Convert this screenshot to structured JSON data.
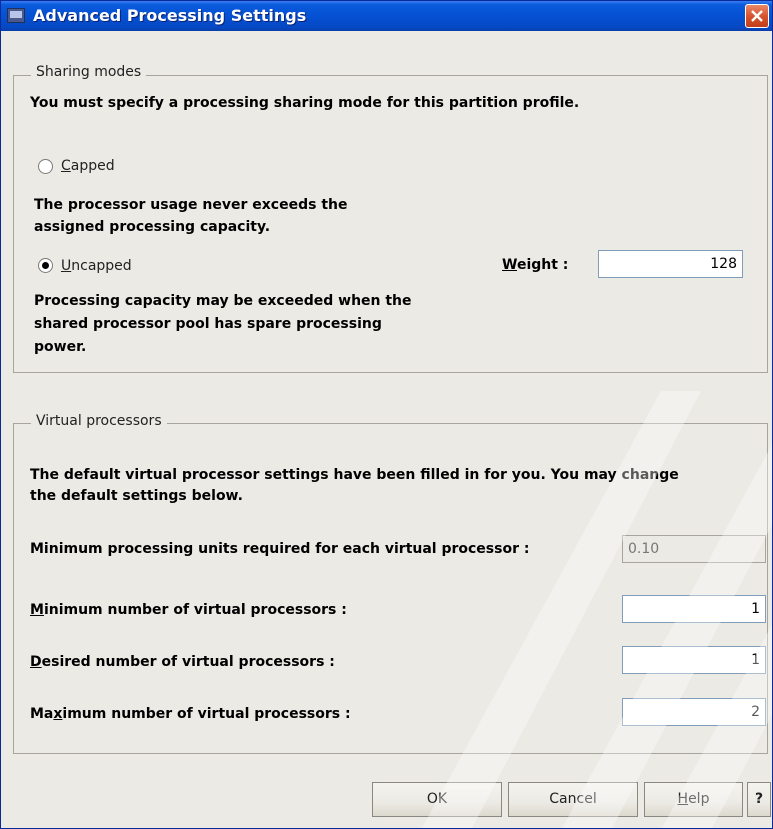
{
  "window": {
    "title": "Advanced Processing Settings"
  },
  "sharing": {
    "legend": "Sharing modes",
    "instruction": "You must specify a processing sharing mode for this partition profile.",
    "capped": {
      "label_mnemonic": "C",
      "label_rest": "apped",
      "selected": false,
      "desc_line1": "The processor usage never exceeds the",
      "desc_line2": "assigned processing capacity."
    },
    "uncapped": {
      "label_mnemonic": "U",
      "label_rest": "ncapped",
      "selected": true,
      "desc_line1": "Processing capacity may be exceeded when the",
      "desc_line2": "shared processor pool has spare processing",
      "desc_line3": "power."
    },
    "weight": {
      "label_mnemonic": "W",
      "label_rest": "eight :",
      "value": "128"
    }
  },
  "virtual": {
    "legend": "Virtual processors",
    "intro_line1": "The default virtual processor settings have been filled in for you. You may change",
    "intro_line2": "the default settings below.",
    "min_units": {
      "label": "Minimum processing units required for each virtual processor :",
      "value": "0.10"
    },
    "min_vp": {
      "label_mnemonic": "M",
      "label_rest": "inimum number of virtual processors :",
      "value": "1"
    },
    "desired_vp": {
      "label_mnemonic": "D",
      "label_rest": "esired number of virtual processors :",
      "value": "1"
    },
    "max_vp": {
      "label_pre": "Ma",
      "label_mnemonic": "x",
      "label_rest": "imum number of virtual processors :",
      "value": "2"
    }
  },
  "buttons": {
    "ok": "OK",
    "cancel": "Cancel",
    "help_mnemonic": "H",
    "help_rest": "elp",
    "question": "?"
  }
}
